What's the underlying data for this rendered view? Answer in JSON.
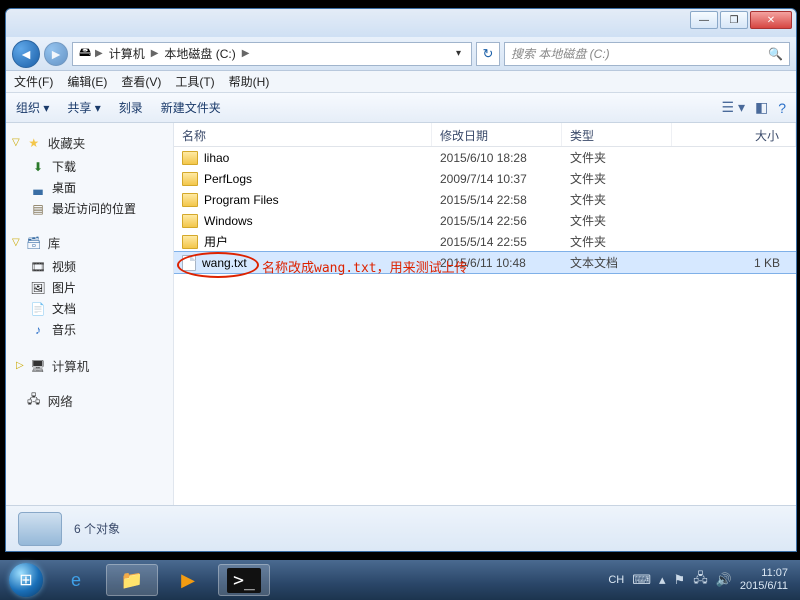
{
  "titlebar": {
    "min": "—",
    "max": "❐",
    "close": "✕"
  },
  "nav": {
    "breadcrumb": [
      "计算机",
      "本地磁盘 (C:)"
    ],
    "search_placeholder": "搜索 本地磁盘 (C:)"
  },
  "menubar": [
    "文件(F)",
    "编辑(E)",
    "查看(V)",
    "工具(T)",
    "帮助(H)"
  ],
  "toolbar": {
    "items": [
      "组织 ▾",
      "共享 ▾",
      "刻录",
      "新建文件夹"
    ]
  },
  "sidebar": {
    "fav": {
      "title": "收藏夹",
      "items": [
        "下载",
        "桌面",
        "最近访问的位置"
      ]
    },
    "lib": {
      "title": "库",
      "items": [
        "视频",
        "图片",
        "文档",
        "音乐"
      ]
    },
    "computer": "计算机",
    "network": "网络"
  },
  "columns": {
    "name": "名称",
    "date": "修改日期",
    "type": "类型",
    "size": "大小"
  },
  "rows": [
    {
      "name": "lihao",
      "date": "2015/6/10 18:28",
      "type": "文件夹",
      "size": "",
      "icon": "folder",
      "sel": false
    },
    {
      "name": "PerfLogs",
      "date": "2009/7/14 10:37",
      "type": "文件夹",
      "size": "",
      "icon": "folder",
      "sel": false
    },
    {
      "name": "Program Files",
      "date": "2015/5/14 22:58",
      "type": "文件夹",
      "size": "",
      "icon": "folder",
      "sel": false
    },
    {
      "name": "Windows",
      "date": "2015/5/14 22:56",
      "type": "文件夹",
      "size": "",
      "icon": "folder",
      "sel": false
    },
    {
      "name": "用户",
      "date": "2015/5/14 22:55",
      "type": "文件夹",
      "size": "",
      "icon": "folder",
      "sel": false
    },
    {
      "name": "wang.txt",
      "date": "2015/6/11 10:48",
      "type": "文本文档",
      "size": "1 KB",
      "icon": "file",
      "sel": true
    }
  ],
  "annotation": "名称改成wang.txt，用来测试上传",
  "details": {
    "count": "6 个对象"
  },
  "tray": {
    "ime": "CH",
    "time": "11:07",
    "date": "2015/6/11"
  }
}
